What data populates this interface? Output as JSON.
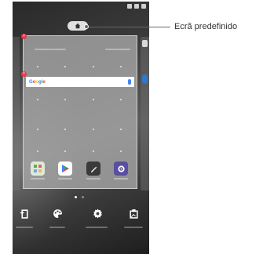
{
  "annotation": {
    "label": "Ecrã predefinido"
  },
  "search": {
    "brand": "Google"
  },
  "icons": {
    "home_button": "home-icon",
    "search_mic": "mic-icon",
    "dock": [
      "contacts-app-icon",
      "play-store-icon",
      "notes-pen-icon",
      "settings-app-icon"
    ],
    "bottom": [
      "widgets-icon",
      "themes-palette-icon",
      "home-settings-gear-icon",
      "wallpaper-icon"
    ]
  },
  "pager": {
    "pages": 2,
    "active": 0
  },
  "colors": {
    "close_badge": "#e53b4b",
    "settings_app": "#5a4ea0",
    "notes_app": "#3a3a3a",
    "callout_line": "#666666"
  }
}
